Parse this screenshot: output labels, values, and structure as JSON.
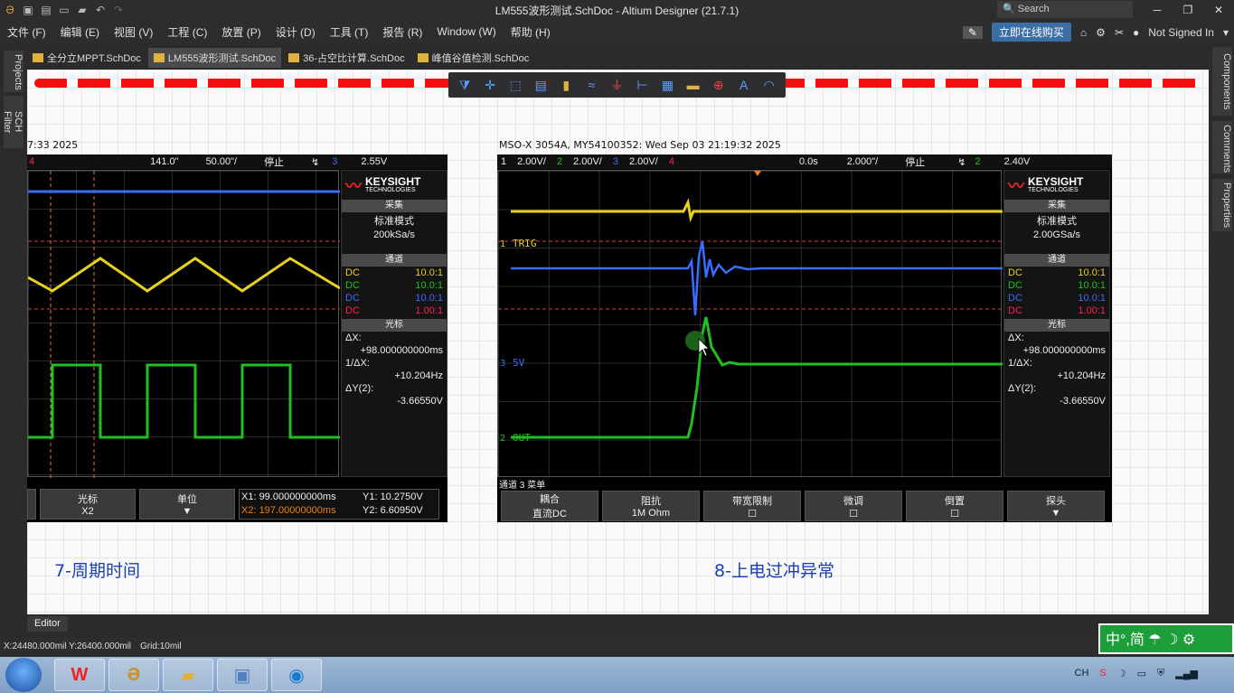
{
  "window": {
    "title": "LM555波形测试.SchDoc - Altium Designer (21.7.1)",
    "search_placeholder": "Search"
  },
  "menu": {
    "items": [
      "文件 (F)",
      "编辑 (E)",
      "视图 (V)",
      "工程 (C)",
      "放置 (P)",
      "设计 (D)",
      "工具 (T)",
      "报告 (R)",
      "Window (W)",
      "帮助 (H)"
    ],
    "buy_label": "立即在线购买",
    "sign_in": "Not Signed In"
  },
  "left_panels": [
    "Projects",
    "SCH Filter"
  ],
  "right_panels": [
    "Components",
    "Comments",
    "Properties"
  ],
  "doc_tabs": [
    {
      "label": "全分立MPPT.SchDoc",
      "active": false
    },
    {
      "label": "LM555波形测试.SchDoc",
      "active": true
    },
    {
      "label": "36-占空比计算.SchDoc",
      "active": false
    },
    {
      "label": "峰值谷值检测.SchDoc",
      "active": false
    }
  ],
  "scope_left": {
    "caption": "7:33 2025",
    "top": {
      "ch4": "4",
      "delay": "141.0\"",
      "timebase": "50.00\"/",
      "state": "停止",
      "trig_ch": "3",
      "level": "2.55V"
    },
    "brand": "KEYSIGHT",
    "brand_sub": "TECHNOLOGIES",
    "acq_header": "采集",
    "acq_mode": "标准模式",
    "acq_rate": "200kSa/s",
    "ch_header": "通道",
    "channels": [
      {
        "cpl": "DC",
        "probe": "10.0:1",
        "color": "#e8d020"
      },
      {
        "cpl": "DC",
        "probe": "10.0:1",
        "color": "#20c020"
      },
      {
        "cpl": "DC",
        "probe": "10.0:1",
        "color": "#3a6cff"
      },
      {
        "cpl": "DC",
        "probe": "1.00:1",
        "color": "#ff2050"
      }
    ],
    "cursor_header": "光标",
    "dx_label": "ΔX:",
    "dx_value": "+98.000000000ms",
    "inv_dx_label": "1/ΔX:",
    "inv_dx_value": "+10.204Hz",
    "dy_label": "ΔY(2):",
    "dy_value": "-3.66550V",
    "softkeys": [
      {
        "top": "光标",
        "bottom": "X2"
      },
      {
        "top": "单位",
        "bottom": "▼"
      }
    ],
    "readout": {
      "x1": "X1: 99.000000000ms",
      "x2": "X2: 197.00000000ms",
      "y1": "Y1: 10.2750V",
      "y2": "Y2: 6.60950V"
    },
    "figure_label": "7-周期时间"
  },
  "scope_right": {
    "caption": "MSO-X 3054A, MY54100352: Wed Sep 03 21:19:32 2025",
    "top": {
      "ch1": "1",
      "ch1_scale": "2.00V/",
      "ch2": "2",
      "ch2_scale": "2.00V/",
      "ch3": "3",
      "ch3_scale": "2.00V/",
      "ch4": "4",
      "delay": "0.0s",
      "timebase": "2.000\"/",
      "state": "停止",
      "trig_ch": "2",
      "level": "2.40V"
    },
    "brand": "KEYSIGHT",
    "brand_sub": "TECHNOLOGIES",
    "acq_header": "采集",
    "acq_mode": "标准模式",
    "acq_rate": "2.00GSa/s",
    "ch_header": "通道",
    "channels": [
      {
        "cpl": "DC",
        "probe": "10.0:1",
        "color": "#e8d020"
      },
      {
        "cpl": "DC",
        "probe": "10.0:1",
        "color": "#20c020"
      },
      {
        "cpl": "DC",
        "probe": "10.0:1",
        "color": "#3a6cff"
      },
      {
        "cpl": "DC",
        "probe": "1.00:1",
        "color": "#ff2050"
      }
    ],
    "cursor_header": "光标",
    "dx_label": "ΔX:",
    "dx_value": "+98.000000000ms",
    "inv_dx_label": "1/ΔX:",
    "inv_dx_value": "+10.204Hz",
    "dy_label": "ΔY(2):",
    "dy_value": "-3.66550V",
    "menu_title": "通道 3 菜单",
    "softkeys": [
      {
        "top": "耦合",
        "bottom": "直流DC"
      },
      {
        "top": "阻抗",
        "bottom": "1M Ohm"
      },
      {
        "top": "带宽限制",
        "bottom": "☐"
      },
      {
        "top": "微调",
        "bottom": "☐"
      },
      {
        "top": "倒置",
        "bottom": "☐"
      },
      {
        "top": "探头",
        "bottom": "▼"
      }
    ],
    "trace_labels": {
      "trig": "TRIG",
      "v5": "5V",
      "out": "OUT"
    },
    "figure_label": "8-上电过冲异常"
  },
  "editor_tab": "Editor",
  "status": {
    "coords": "X:24480.000mil Y:26400.000mil",
    "grid": "Grid:10mil"
  },
  "ime": "中°,简 ☂ ☽ ⚙",
  "tray_lang": "CH"
}
